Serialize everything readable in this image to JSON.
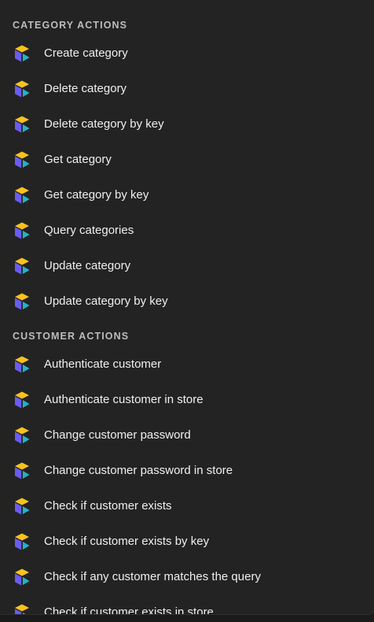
{
  "sections": [
    {
      "header": "CATEGORY ACTIONS",
      "items": [
        {
          "label": "Create category",
          "icon": "commercetools-icon"
        },
        {
          "label": "Delete category",
          "icon": "commercetools-icon"
        },
        {
          "label": "Delete category by key",
          "icon": "commercetools-icon"
        },
        {
          "label": "Get category",
          "icon": "commercetools-icon"
        },
        {
          "label": "Get category by key",
          "icon": "commercetools-icon"
        },
        {
          "label": "Query categories",
          "icon": "commercetools-icon"
        },
        {
          "label": "Update category",
          "icon": "commercetools-icon"
        },
        {
          "label": "Update category by key",
          "icon": "commercetools-icon"
        }
      ]
    },
    {
      "header": "CUSTOMER ACTIONS",
      "items": [
        {
          "label": "Authenticate customer",
          "icon": "commercetools-icon"
        },
        {
          "label": "Authenticate customer in store",
          "icon": "commercetools-icon"
        },
        {
          "label": "Change customer password",
          "icon": "commercetools-icon"
        },
        {
          "label": "Change customer password in store",
          "icon": "commercetools-icon"
        },
        {
          "label": "Check if customer exists",
          "icon": "commercetools-icon"
        },
        {
          "label": "Check if customer exists by key",
          "icon": "commercetools-icon"
        },
        {
          "label": "Check if any customer matches the query",
          "icon": "commercetools-icon"
        },
        {
          "label": "Check if customer exists in store",
          "icon": "commercetools-icon"
        }
      ]
    }
  ],
  "colors": {
    "background": "#232323",
    "text": "#f0f0f0",
    "header": "#bdbdbd",
    "icon_yellow": "#f7c21e",
    "icon_purple": "#6a5cf0",
    "icon_teal": "#1fb5c9"
  }
}
